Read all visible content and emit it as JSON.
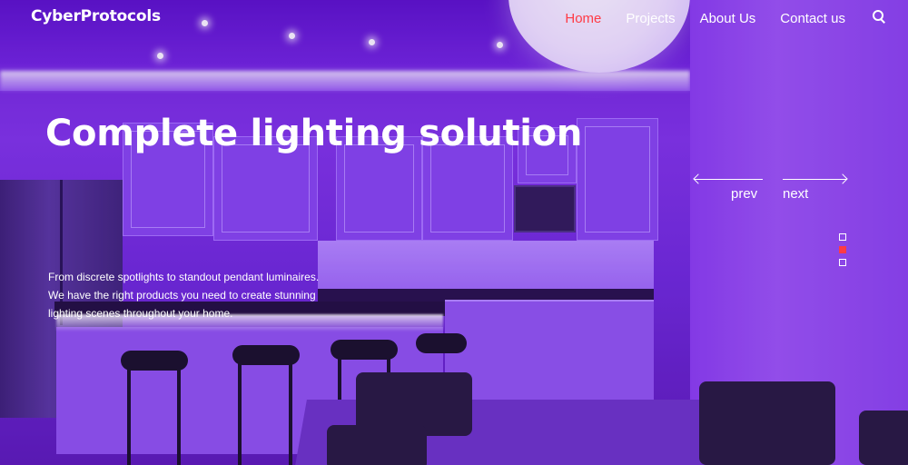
{
  "brand": {
    "logo": "CyberProtocols"
  },
  "nav": {
    "items": [
      {
        "label": "Home",
        "active": true
      },
      {
        "label": "Projects",
        "active": false
      },
      {
        "label": "About Us",
        "active": false
      },
      {
        "label": "Contact us",
        "active": false
      }
    ],
    "search_icon": "search-icon"
  },
  "hero": {
    "title": "Complete lighting solution",
    "text": "From discrete spotlights to standout pendant luminaires.\nWe have the right products you need to create stunning\nlighting scenes throughout your home."
  },
  "slider": {
    "prev_label": "prev",
    "next_label": "next",
    "slide_count": 3,
    "active_slide": 2
  },
  "colors": {
    "accent": "#ff3b45",
    "text": "#ffffff",
    "background_tint": "#6a1fd6"
  }
}
